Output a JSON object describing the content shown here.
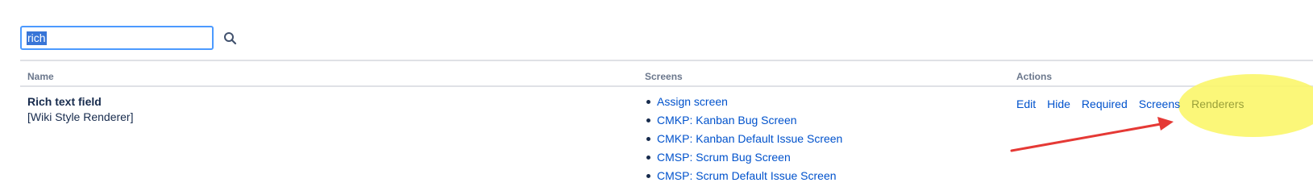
{
  "search": {
    "value": "rich"
  },
  "table": {
    "headers": {
      "name": "Name",
      "screens": "Screens",
      "actions": "Actions"
    },
    "row": {
      "name": "Rich text field",
      "renderer": "[Wiki Style Renderer]",
      "screens": [
        "Assign screen",
        "CMKP: Kanban Bug Screen",
        "CMKP: Kanban Default Issue Screen",
        "CMSP: Scrum Bug Screen",
        "CMSP: Scrum Default Issue Screen"
      ],
      "actions": {
        "edit": "Edit",
        "hide": "Hide",
        "required": "Required",
        "screens": "Screens",
        "renderers": "Renderers"
      }
    }
  },
  "annotation": {
    "highlight_color": "#fbf66a",
    "arrow_color": "#e53935"
  }
}
